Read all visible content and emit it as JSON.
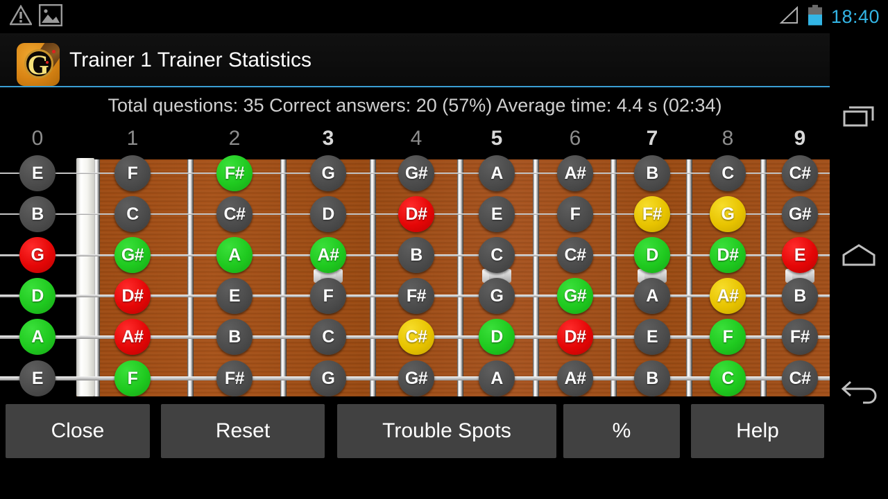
{
  "statusbar": {
    "time": "18:40",
    "icons": [
      "warning-icon",
      "screenshot-icon",
      "signal-icon",
      "battery-icon"
    ]
  },
  "titlebar": {
    "app_icon": "guitar-app-icon",
    "title": "Trainer 1 Trainer Statistics"
  },
  "stats": {
    "line": "Total questions: 35 Correct answers: 20 (57%) Average time: 4.4 s (02:34)",
    "total_questions": 35,
    "correct_answers": 20,
    "correct_percent": "57%",
    "average_time": "4.4 s",
    "total_time": "02:34"
  },
  "fretboard": {
    "fret_numbers": [
      "0",
      "1",
      "2",
      "3",
      "4",
      "5",
      "6",
      "7",
      "8",
      "9"
    ],
    "marker_frets": [
      3,
      5,
      7,
      9
    ],
    "colors": {
      "unanswered": "#4a4a4a",
      "correct": "#1fc91f",
      "wrong": "#e40606",
      "partial": "#e7c300",
      "wood": "#a8531a",
      "nut": "#ffffff"
    },
    "strings": [
      "E",
      "B",
      "G",
      "D",
      "A",
      "E"
    ],
    "rows": [
      {
        "string": "E",
        "notes": [
          {
            "label": "E",
            "state": "grey"
          },
          {
            "label": "F",
            "state": "grey"
          },
          {
            "label": "F#",
            "state": "green"
          },
          {
            "label": "G",
            "state": "grey"
          },
          {
            "label": "G#",
            "state": "grey"
          },
          {
            "label": "A",
            "state": "grey"
          },
          {
            "label": "A#",
            "state": "grey"
          },
          {
            "label": "B",
            "state": "grey"
          },
          {
            "label": "C",
            "state": "grey"
          },
          {
            "label": "C#",
            "state": "grey"
          }
        ]
      },
      {
        "string": "B",
        "notes": [
          {
            "label": "B",
            "state": "grey"
          },
          {
            "label": "C",
            "state": "grey"
          },
          {
            "label": "C#",
            "state": "grey"
          },
          {
            "label": "D",
            "state": "grey"
          },
          {
            "label": "D#",
            "state": "red"
          },
          {
            "label": "E",
            "state": "grey"
          },
          {
            "label": "F",
            "state": "grey"
          },
          {
            "label": "F#",
            "state": "yellow"
          },
          {
            "label": "G",
            "state": "yellow"
          },
          {
            "label": "G#",
            "state": "grey"
          }
        ]
      },
      {
        "string": "G",
        "notes": [
          {
            "label": "G",
            "state": "red"
          },
          {
            "label": "G#",
            "state": "green"
          },
          {
            "label": "A",
            "state": "green"
          },
          {
            "label": "A#",
            "state": "green"
          },
          {
            "label": "B",
            "state": "grey"
          },
          {
            "label": "C",
            "state": "grey"
          },
          {
            "label": "C#",
            "state": "grey"
          },
          {
            "label": "D",
            "state": "green"
          },
          {
            "label": "D#",
            "state": "green"
          },
          {
            "label": "E",
            "state": "red"
          }
        ]
      },
      {
        "string": "D",
        "notes": [
          {
            "label": "D",
            "state": "green"
          },
          {
            "label": "D#",
            "state": "red"
          },
          {
            "label": "E",
            "state": "grey"
          },
          {
            "label": "F",
            "state": "grey"
          },
          {
            "label": "F#",
            "state": "grey"
          },
          {
            "label": "G",
            "state": "grey"
          },
          {
            "label": "G#",
            "state": "green"
          },
          {
            "label": "A",
            "state": "grey"
          },
          {
            "label": "A#",
            "state": "yellow"
          },
          {
            "label": "B",
            "state": "grey"
          }
        ]
      },
      {
        "string": "A",
        "notes": [
          {
            "label": "A",
            "state": "green"
          },
          {
            "label": "A#",
            "state": "red"
          },
          {
            "label": "B",
            "state": "grey"
          },
          {
            "label": "C",
            "state": "grey"
          },
          {
            "label": "C#",
            "state": "yellow"
          },
          {
            "label": "D",
            "state": "green"
          },
          {
            "label": "D#",
            "state": "red"
          },
          {
            "label": "E",
            "state": "grey"
          },
          {
            "label": "F",
            "state": "green"
          },
          {
            "label": "F#",
            "state": "grey"
          }
        ]
      },
      {
        "string": "E",
        "notes": [
          {
            "label": "E",
            "state": "grey"
          },
          {
            "label": "F",
            "state": "green"
          },
          {
            "label": "F#",
            "state": "grey"
          },
          {
            "label": "G",
            "state": "grey"
          },
          {
            "label": "G#",
            "state": "grey"
          },
          {
            "label": "A",
            "state": "grey"
          },
          {
            "label": "A#",
            "state": "grey"
          },
          {
            "label": "B",
            "state": "grey"
          },
          {
            "label": "C",
            "state": "green"
          },
          {
            "label": "C#",
            "state": "grey"
          }
        ]
      }
    ]
  },
  "buttons": [
    {
      "label": "Close",
      "name": "close-button"
    },
    {
      "label": "Reset",
      "name": "reset-button"
    },
    {
      "label": "Trouble Spots",
      "name": "trouble-spots-button"
    },
    {
      "label": "%",
      "name": "percent-button"
    },
    {
      "label": "Help",
      "name": "help-button"
    }
  ],
  "navbar": {
    "recents": "recents-icon",
    "home": "home-icon",
    "back": "back-icon"
  }
}
